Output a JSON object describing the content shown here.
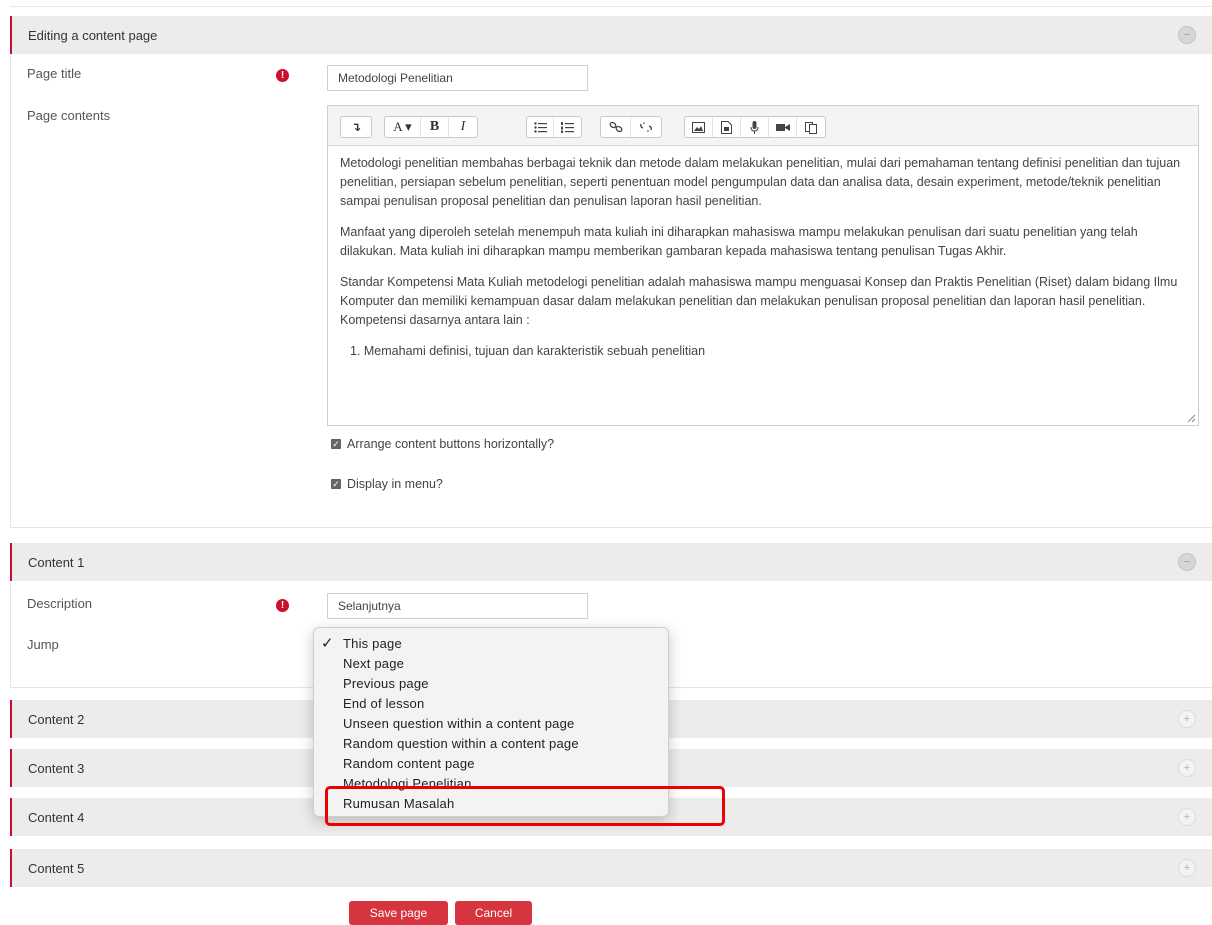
{
  "sections": {
    "editing": {
      "title": "Editing a content page",
      "page_title_label": "Page title",
      "page_title_value": "Metodologi Penelitian",
      "page_contents_label": "Page contents",
      "editor_paragraphs": [
        "Metodologi penelitian  membahas berbagai teknik dan metode dalam melakukan penelitian, mulai dari pemahaman tentang definisi penelitian dan tujuan penelitian, persiapan sebelum penelitian, seperti penentuan model pengumpulan data dan analisa data, desain experiment, metode/teknik penelitian sampai penulisan  proposal penelitian dan penulisan laporan hasil penelitian.",
        "Manfaat yang diperoleh setelah menempuh mata kuliah ini diharapkan mahasiswa mampu melakukan penulisan dari suatu penelitian yang telah dilakukan. Mata kuliah ini diharapkan  mampu memberikan gambaran kepada mahasiswa tentang penulisan Tugas Akhir.",
        "Standar Kompetensi Mata Kuliah metodelogi penelitian adalah mahasiswa mampu menguasai Konsep dan Praktis Penelitian (Riset) dalam bidang Ilmu Komputer dan memiliki kemampuan dasar dalam melakukan penelitian dan melakukan penulisan proposal penelitian dan laporan hasil penelitian. Kompetensi dasarnya antara lain :"
      ],
      "editor_list_item": "1.   Memahami definisi, tujuan dan karakteristik sebuah penelitian",
      "toolbar": {
        "font_button": "A ▾",
        "bold": "B",
        "italic": "I"
      },
      "arrange_label": "Arrange content buttons horizontally?",
      "display_menu_label": "Display in menu?"
    },
    "content1": {
      "title": "Content 1",
      "description_label": "Description",
      "description_value": "Selanjutnya",
      "jump_label": "Jump"
    },
    "collapsed": [
      {
        "title": "Content 2"
      },
      {
        "title": "Content 3"
      },
      {
        "title": "Content 4"
      },
      {
        "title": "Content 5"
      }
    ]
  },
  "jump_dropdown": {
    "selected": "This page",
    "options": [
      "This page",
      "Next page",
      "Previous page",
      "End of lesson",
      "Unseen question within a content page",
      "Random question within a content page",
      "Random content page",
      "Metodologi Penelitian",
      "Rumusan Masalah"
    ]
  },
  "buttons": {
    "save": "Save page",
    "cancel": "Cancel"
  },
  "colors": {
    "accent": "#c8102e",
    "button": "#d6343f",
    "highlight": "#ee0000"
  }
}
